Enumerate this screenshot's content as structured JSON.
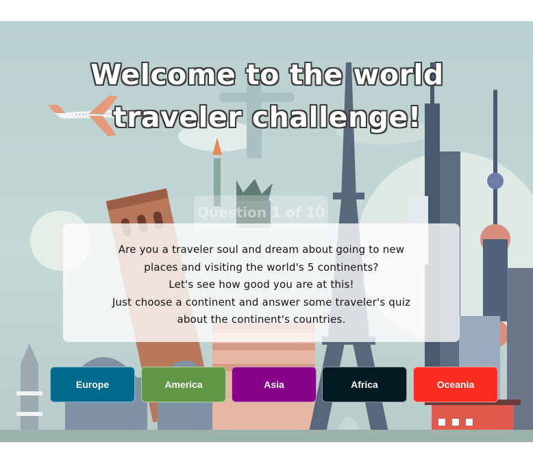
{
  "hero": {
    "title_line1": "Welcome to the world",
    "title_line2": "traveler challenge!"
  },
  "ghost_counter": "Question 1 of 10",
  "intro": {
    "lines": [
      "Are you a traveler soul and dream about going to new",
      "places and visiting the world's 5 continents?",
      "Let's see how good you are at this!",
      "Just choose a continent and answer some traveler's quiz",
      "about the continent's countries."
    ]
  },
  "continents": [
    {
      "label": "Europe",
      "color": "#006b8f"
    },
    {
      "label": "America",
      "color": "#5f9743"
    },
    {
      "label": "Asia",
      "color": "#86038a"
    },
    {
      "label": "Africa",
      "color": "#041b24"
    },
    {
      "label": "Oceania",
      "color": "#fb2d20"
    }
  ]
}
